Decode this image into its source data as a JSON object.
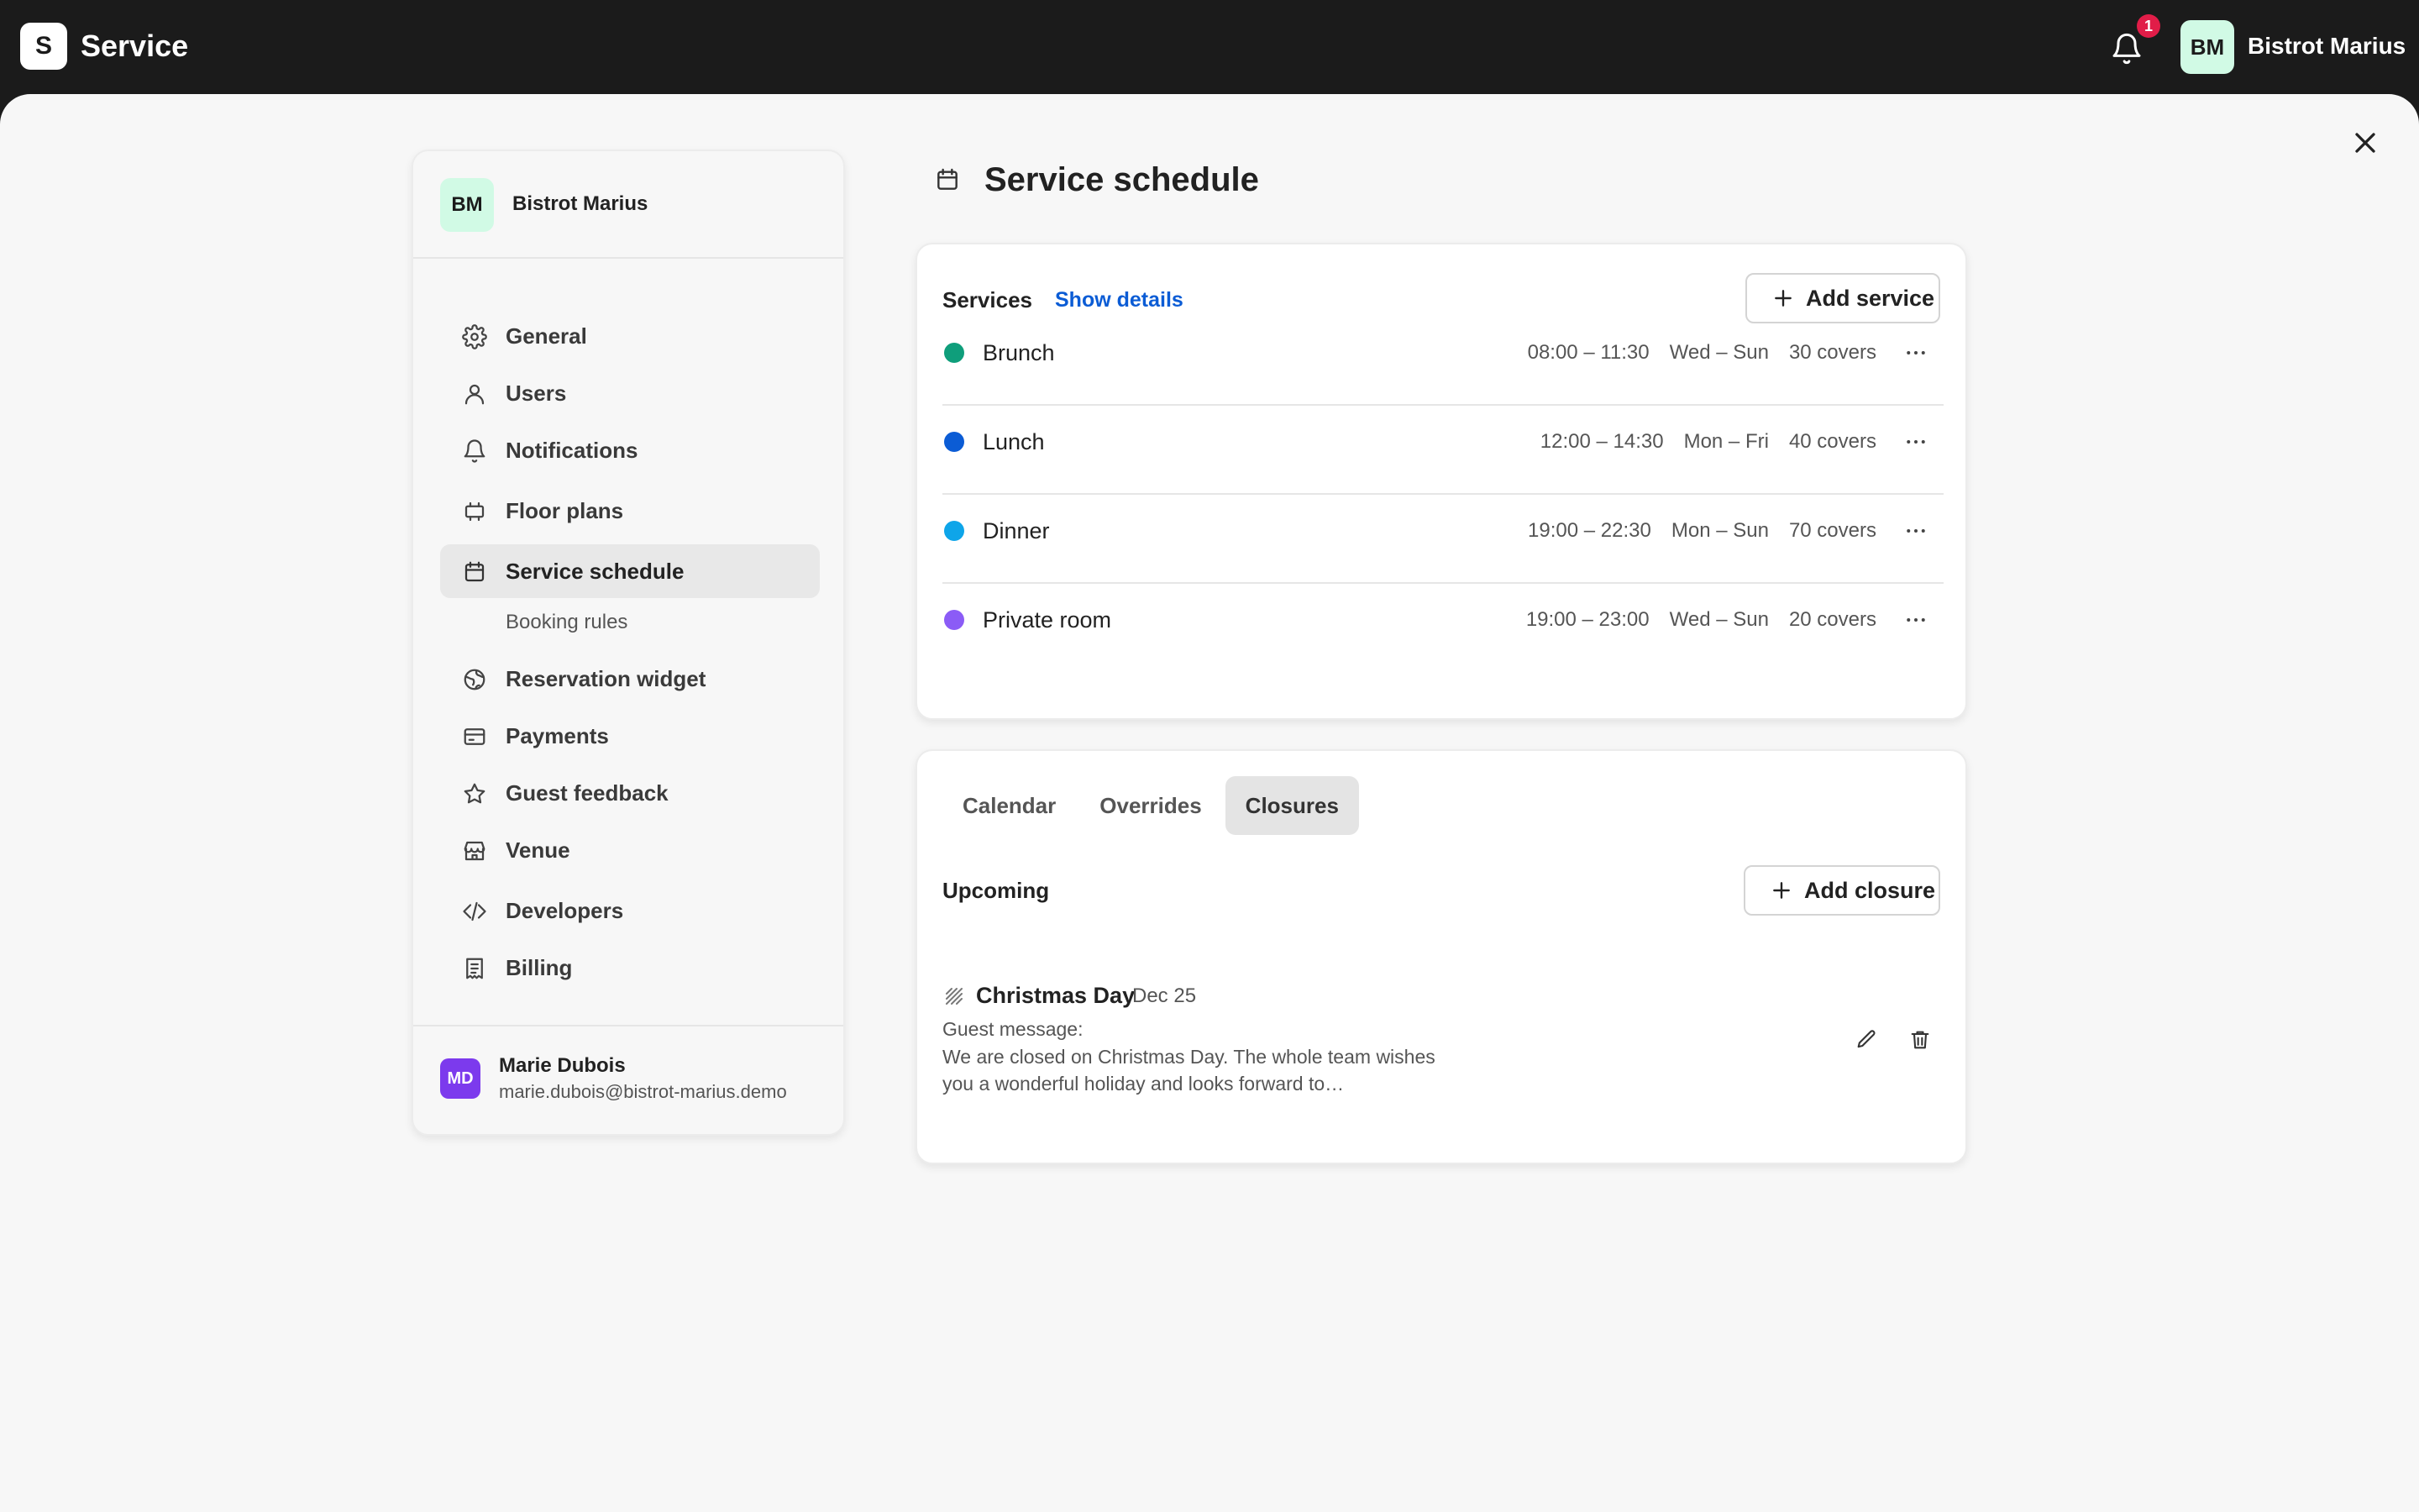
{
  "topbar": {
    "logo_letter": "S",
    "app_title": "Service",
    "notification_count": "1",
    "avatar_initials": "BM",
    "venue_name": "Bistrot Marius"
  },
  "sidebar": {
    "avatar_initials": "BM",
    "venue_name": "Bistrot Marius",
    "items": [
      {
        "label": "General",
        "icon": "gear-icon"
      },
      {
        "label": "Users",
        "icon": "user-icon"
      },
      {
        "label": "Notifications",
        "icon": "bell-icon"
      },
      {
        "label": "Floor plans",
        "icon": "floor-plan-icon"
      },
      {
        "label": "Service schedule",
        "icon": "calendar-icon",
        "active": true
      },
      {
        "label": "Reservation widget",
        "icon": "globe-icon"
      },
      {
        "label": "Payments",
        "icon": "credit-card-icon"
      },
      {
        "label": "Guest feedback",
        "icon": "star-icon"
      },
      {
        "label": "Venue",
        "icon": "store-icon"
      },
      {
        "label": "Developers",
        "icon": "code-icon"
      },
      {
        "label": "Billing",
        "icon": "receipt-icon"
      }
    ],
    "subitem": "Booking rules",
    "user": {
      "initials": "MD",
      "name": "Marie Dubois",
      "email": "marie.dubois@bistrot-marius.demo"
    }
  },
  "page": {
    "title": "Service schedule"
  },
  "services": {
    "heading": "Services",
    "show_details": "Show details",
    "add_button": "Add service",
    "rows": [
      {
        "name": "Brunch",
        "time": "08:00 – 11:30",
        "days": "Wed – Sun",
        "covers": "30 covers",
        "color": "#0f9e7b"
      },
      {
        "name": "Lunch",
        "time": "12:00 – 14:30",
        "days": "Mon – Fri",
        "covers": "40 covers",
        "color": "#0b5cd5"
      },
      {
        "name": "Dinner",
        "time": "19:00 – 22:30",
        "days": "Mon – Sun",
        "covers": "70 covers",
        "color": "#0ea5e9"
      },
      {
        "name": "Private room",
        "time": "19:00 – 23:00",
        "days": "Wed – Sun",
        "covers": "20 covers",
        "color": "#8b5cf6"
      }
    ]
  },
  "closures": {
    "tabs": [
      "Calendar",
      "Overrides",
      "Closures"
    ],
    "active_tab": "Closures",
    "section_title": "Upcoming",
    "add_button": "Add closure",
    "items": [
      {
        "name": "Christmas Day",
        "date": "Dec 25",
        "message_label": "Guest message:",
        "message": "We are closed on Christmas Day. The whole team wishes you a wonderful holiday and looks forward to…"
      }
    ]
  }
}
